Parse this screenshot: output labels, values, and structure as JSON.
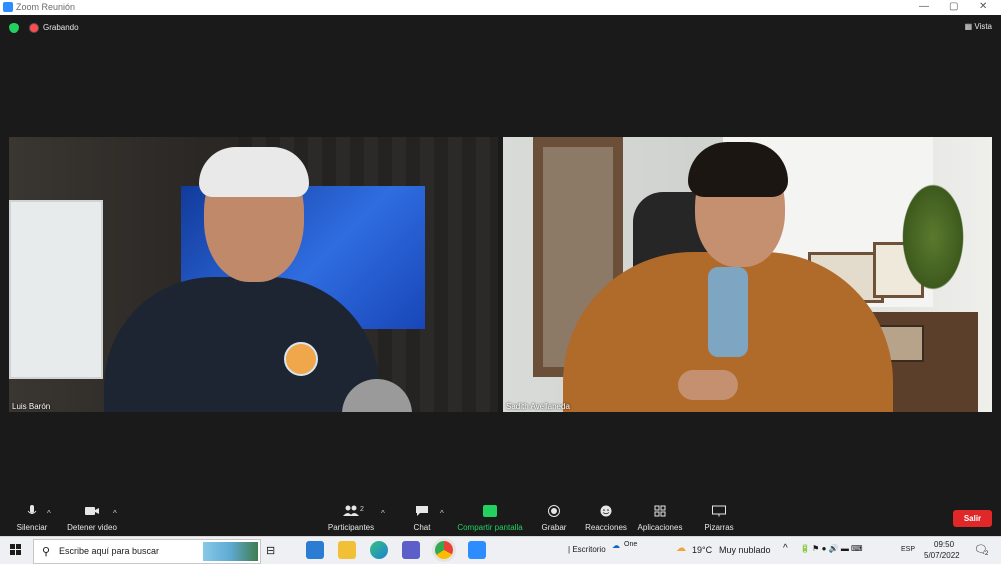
{
  "window": {
    "title": "Zoom Reunión",
    "controls": [
      "—",
      "▢",
      "✕"
    ]
  },
  "meeting": {
    "recording_label": "Grabando",
    "view_label": "Vista",
    "participants": [
      {
        "name": "Luis Barón"
      },
      {
        "name": "Sadith Avellaneda"
      }
    ]
  },
  "toolbar": {
    "mute": "Silenciar",
    "stop_video": "Detener video",
    "participants": "Participantes",
    "participants_count": "2",
    "chat": "Chat",
    "share": "Compartir pantalla",
    "record": "Grabar",
    "reactions": "Reacciones",
    "apps": "Aplicaciones",
    "whiteboards": "Pizarras",
    "leave": "Salir"
  },
  "taskbar": {
    "search_placeholder": "Escribe aquí para buscar",
    "desktop_label": "Escritorio",
    "onedrive_label": "One",
    "weather_temp": "19°C",
    "weather_desc": "Muy nublado",
    "language": "ESP",
    "time": "09:50",
    "date": "5/07/2022",
    "notifications": "2"
  },
  "colors": {
    "zoom_blue": "#2d8cff",
    "share_green": "#23d160",
    "leave_red": "#e02828",
    "background": "#1a1a1a"
  }
}
